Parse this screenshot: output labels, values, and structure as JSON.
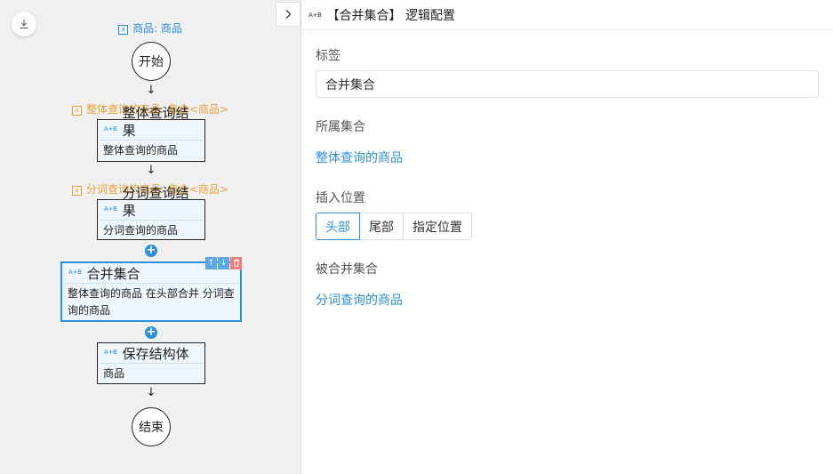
{
  "canvas": {
    "download_icon": "download-icon",
    "start_var": "商品: 商品",
    "start_label": "开始",
    "var1": "整体查询的商品: 集合<商品>",
    "node1": {
      "title": "整体查询结果",
      "body": "整体查询的商品"
    },
    "var2": "分词查询的商品: 集合<商品>",
    "node2": {
      "title": "分词查询结果",
      "body": "分词查询的商品"
    },
    "node3": {
      "title": "合并集合",
      "body": "整体查询的商品 在头部合并 分词查询的商品"
    },
    "node4": {
      "title": "保存结构体",
      "body": "商品"
    },
    "end_label": "结束",
    "arrow": "↓",
    "plus": "+",
    "ab_badge": "A+B"
  },
  "panel": {
    "ab_badge": "A+B",
    "title": "【合并集合】 逻辑配置",
    "label_caption": "标签",
    "label_value": "合并集合",
    "collection_caption": "所属集合",
    "collection_value": "整体查询的商品",
    "position_caption": "插入位置",
    "position_options": [
      "头部",
      "尾部",
      "指定位置"
    ],
    "position_selected": "头部",
    "merged_caption": "被合并集合",
    "merged_value": "分词查询的商品"
  },
  "colors": {
    "accent": "#2b8fdb",
    "variable": "#e8a23a",
    "delete": "#f07c7c"
  }
}
